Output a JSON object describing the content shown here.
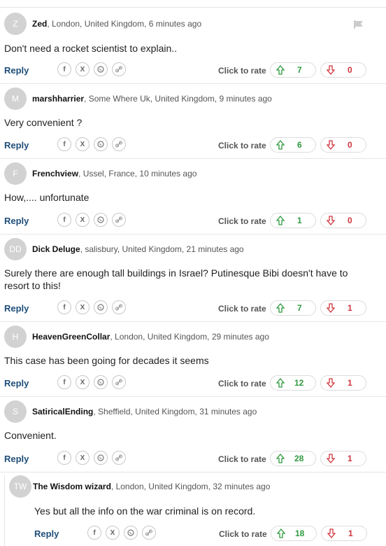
{
  "colors": {
    "upvote": "#2e9a3e",
    "downvote": "#d0343c",
    "reply": "#1f4e79",
    "avatar": "#d2d2d2"
  },
  "icons": {
    "flag": "flag-icon",
    "facebook": "facebook-icon",
    "x": "x-icon",
    "whatsapp": "whatsapp-icon",
    "link": "link-icon",
    "upvote": "arrow-up-icon",
    "downvote": "arrow-down-icon"
  },
  "labels": {
    "reply": "Reply",
    "rate": "Click to rate",
    "facebook": "f",
    "x": "X"
  },
  "comments": [
    {
      "initials": "Z",
      "username": "Zed",
      "location": ", London, United Kingdom, 6 minutes ago",
      "body": "Don't need a rocket scientist to explain..",
      "up": "7",
      "down": "0",
      "flag": true
    },
    {
      "initials": "M",
      "username": "marshharrier",
      "location": ", Some Where Uk, United Kingdom, 9 minutes ago",
      "body": "Very convenient ?",
      "up": "6",
      "down": "0"
    },
    {
      "initials": "F",
      "username": "Frenchview",
      "location": ", Ussel, France, 10 minutes ago",
      "body": "How,.... unfortunate",
      "up": "1",
      "down": "0"
    },
    {
      "initials": "DD",
      "username": "Dick Deluge",
      "location": ", salisbury, United Kingdom, 21 minutes ago",
      "body": "Surely there are enough tall buildings in Israel? Putinesque Bibi doesn't have to resort to this!",
      "up": "7",
      "down": "1"
    },
    {
      "initials": "H",
      "username": "HeavenGreenCollar",
      "location": ", London, United Kingdom, 29 minutes ago",
      "body": "This case has been going for decades it seems",
      "up": "12",
      "down": "1"
    },
    {
      "initials": "S",
      "username": "SatiricalEnding",
      "location": ", Sheffield, United Kingdom, 31 minutes ago",
      "body": "Convenient.",
      "up": "28",
      "down": "1"
    },
    {
      "initials": "TW",
      "username": "The Wisdom wizard",
      "location": ", London, United Kingdom, 32 minutes ago",
      "body": "Yes but all the info on the war criminal is on record.",
      "up": "18",
      "down": "1",
      "nested": true
    }
  ]
}
